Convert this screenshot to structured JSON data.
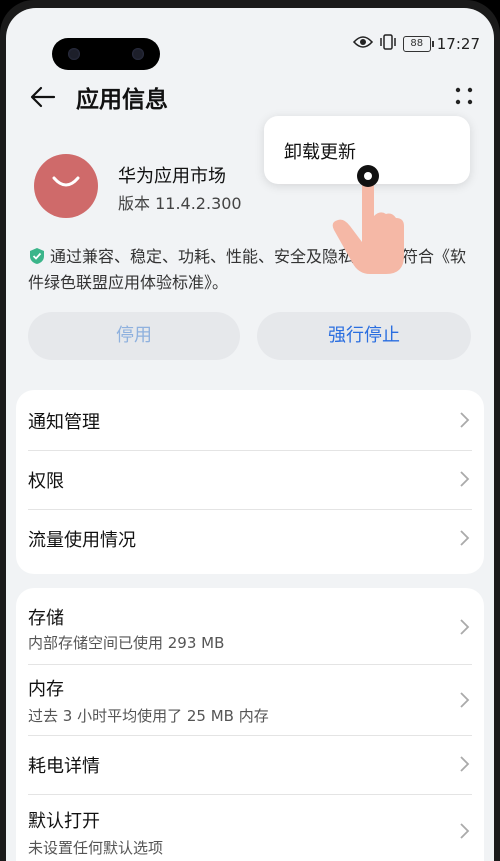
{
  "status_bar": {
    "time": "17:27",
    "battery": "88"
  },
  "header": {
    "title": "应用信息"
  },
  "app": {
    "name": "华为应用市场",
    "version": "版本 11.4.2.300"
  },
  "compat_note": "通过兼容、稳定、功耗、性能、安全及隐私检测，符合《软件绿色联盟应用体验标准》。",
  "buttons": {
    "disable": "停用",
    "force_stop": "强行停止"
  },
  "menu": {
    "uninstall_updates": "卸载更新"
  },
  "settings_group1": [
    {
      "label": "通知管理"
    },
    {
      "label": "权限"
    },
    {
      "label": "流量使用情况"
    }
  ],
  "settings_group2": [
    {
      "label": "存储",
      "sub": "内部存储空间已使用 293 MB"
    },
    {
      "label": "内存",
      "sub": "过去 3 小时平均使用了 25 MB 内存"
    },
    {
      "label": "耗电详情"
    },
    {
      "label": "默认打开",
      "sub": "未设置任何默认选项"
    }
  ],
  "colors": {
    "accent": "#2a6ee0",
    "app_icon": "#cf6a6a",
    "disabled_text": "#8fb1de"
  }
}
